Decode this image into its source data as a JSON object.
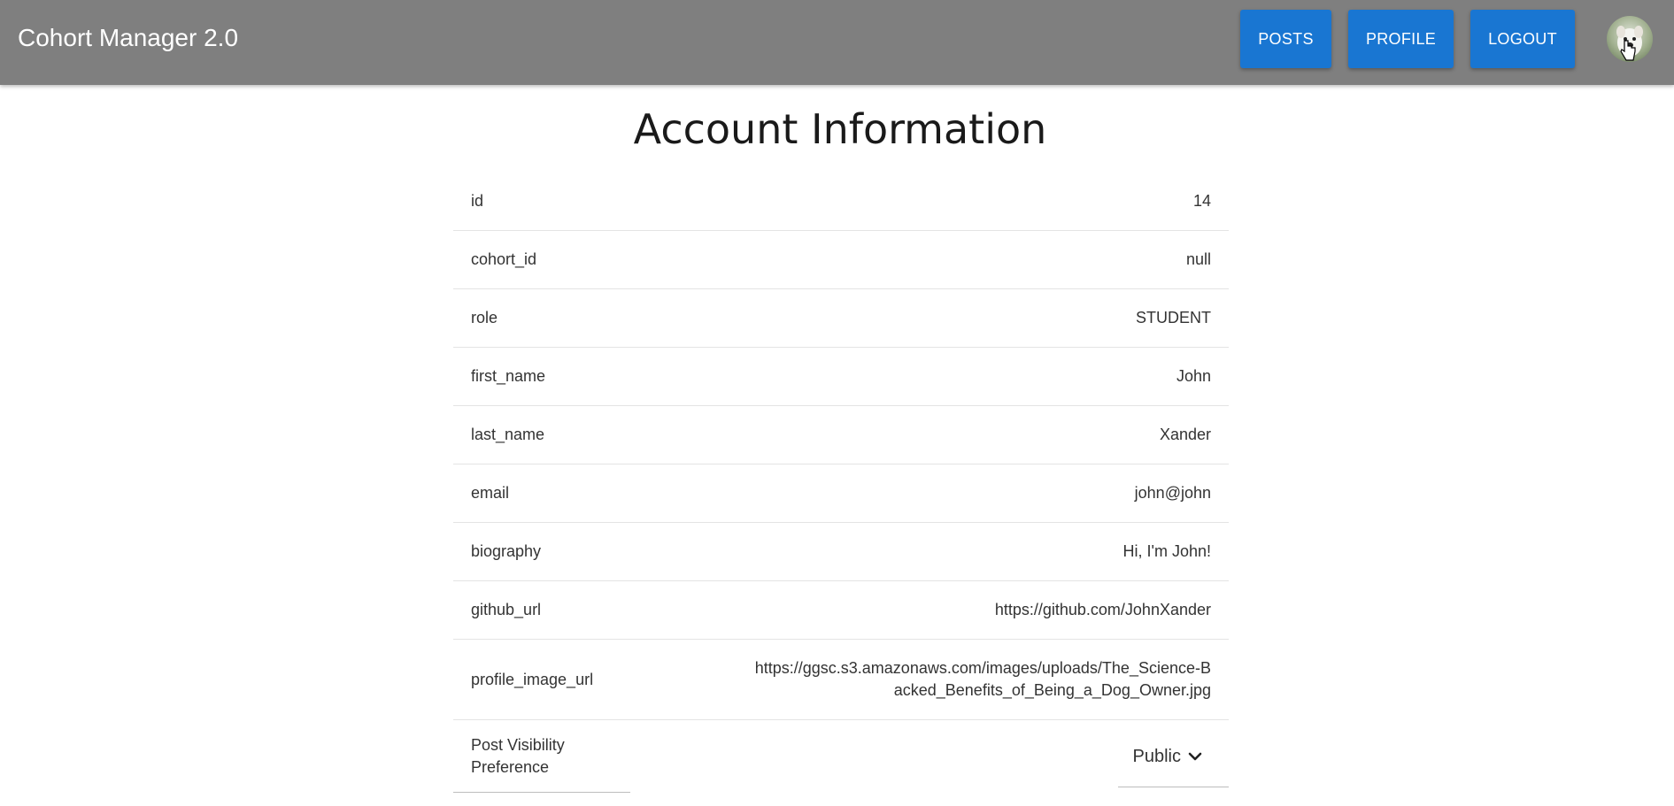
{
  "header": {
    "app_title": "Cohort Manager 2.0",
    "posts_label": "POSTS",
    "profile_label": "PROFILE",
    "logout_label": "LOGOUT",
    "avatar_icon": "dog-avatar-icon"
  },
  "page": {
    "title": "Account Information"
  },
  "account": {
    "rows": [
      {
        "key": "id",
        "value": "14"
      },
      {
        "key": "cohort_id",
        "value": "null"
      },
      {
        "key": "role",
        "value": "STUDENT"
      },
      {
        "key": "first_name",
        "value": "John"
      },
      {
        "key": "last_name",
        "value": "Xander"
      },
      {
        "key": "email",
        "value": "john@john"
      },
      {
        "key": "biography",
        "value": "Hi, I'm John!"
      },
      {
        "key": "github_url",
        "value": "https://github.com/JohnXander"
      },
      {
        "key": "profile_image_url",
        "value": "https://ggsc.s3.amazonaws.com/images/uploads/The_Science-Backed_Benefits_of_Being_a_Dog_Owner.jpg"
      }
    ],
    "visibility": {
      "label": "Post Visibility Preference",
      "selected": "Public",
      "icon": "chevron-down-icon"
    }
  },
  "colors": {
    "header_bg": "#7f7f7f",
    "button_bg": "#1976d2",
    "button_text": "#ffffff"
  }
}
